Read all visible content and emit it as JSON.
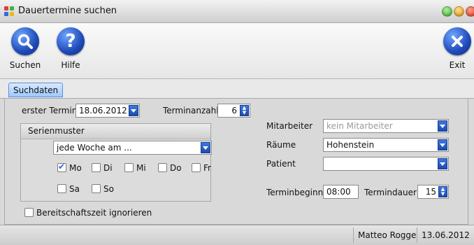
{
  "window": {
    "title": "Dauertermine suchen"
  },
  "colors": {
    "accent": "#1f49b8",
    "tab": "#9ec8ff",
    "close": "#e84a2f",
    "minimize": "#f1a51e",
    "zoom": "#55b944"
  },
  "toolbar": {
    "search_label": "Suchen",
    "search_icon": "search-icon",
    "help_label": "Hilfe",
    "help_icon": "help-icon",
    "exit_label": "Exit",
    "exit_icon": "close-icon"
  },
  "tabs": [
    {
      "label": "Suchdaten",
      "active": true
    }
  ],
  "form": {
    "first_term_label": "erster Termin",
    "first_term_value": "18.06.2012",
    "count_label": "Terminanzahl",
    "count_value": "6",
    "series_title": "Serienmuster",
    "pattern_value": "jede Woche am ...",
    "days": [
      {
        "label": "Mo",
        "checked": true
      },
      {
        "label": "Di",
        "checked": false
      },
      {
        "label": "Mi",
        "checked": false
      },
      {
        "label": "Do",
        "checked": false
      },
      {
        "label": "Fr",
        "checked": false
      },
      {
        "label": "Sa",
        "checked": false
      },
      {
        "label": "So",
        "checked": false
      }
    ],
    "standby_label": "Bereitschaftszeit ignorieren",
    "standby_checked": false,
    "employee_label": "Mitarbeiter",
    "employee_value": "kein Mitarbeiter",
    "rooms_label": "Räume",
    "rooms_value": "Hohenstein",
    "patient_label": "Patient",
    "patient_value": "",
    "start_label": "Terminbeginn",
    "start_value": "08:00",
    "duration_label": "Termindauer",
    "duration_value": "15"
  },
  "status": {
    "user": "Matteo Rogge",
    "date": "13.06.2012"
  }
}
